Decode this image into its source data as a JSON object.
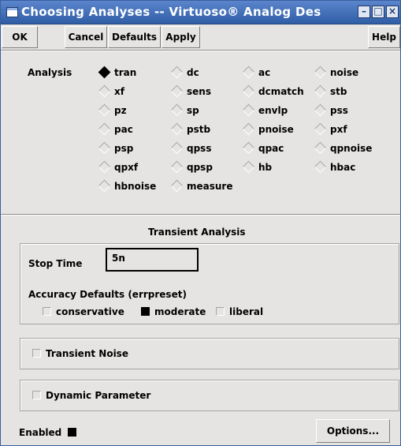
{
  "window": {
    "title": "Choosing Analyses -- Virtuoso® Analog Des",
    "controls": [
      "–",
      "□",
      "×"
    ]
  },
  "toolbar": {
    "ok": "OK",
    "cancel": "Cancel",
    "defaults": "Defaults",
    "apply": "Apply",
    "help": "Help"
  },
  "analysis": {
    "label": "Analysis",
    "selected": "tran",
    "options": [
      [
        "tran",
        "dc",
        "ac",
        "noise"
      ],
      [
        "xf",
        "sens",
        "dcmatch",
        "stb"
      ],
      [
        "pz",
        "sp",
        "envlp",
        "pss"
      ],
      [
        "pac",
        "pstb",
        "pnoise",
        "pxf"
      ],
      [
        "psp",
        "qpss",
        "qpac",
        "qpnoise"
      ],
      [
        "qpxf",
        "qpsp",
        "hb",
        "hbac"
      ],
      [
        "hbnoise",
        "measure"
      ]
    ]
  },
  "transient": {
    "heading": "Transient Analysis",
    "stop_time_label": "Stop Time",
    "stop_time_value": "5n",
    "accuracy_label": "Accuracy Defaults (errpreset)",
    "accuracy_options": [
      "conservative",
      "moderate",
      "liberal"
    ],
    "accuracy_selected": "moderate"
  },
  "transient_noise": {
    "label": "Transient Noise",
    "checked": false
  },
  "dynamic_parameter": {
    "label": "Dynamic Parameter",
    "checked": false
  },
  "footer": {
    "enabled_label": "Enabled",
    "enabled_checked": true,
    "options_button": "Options..."
  }
}
